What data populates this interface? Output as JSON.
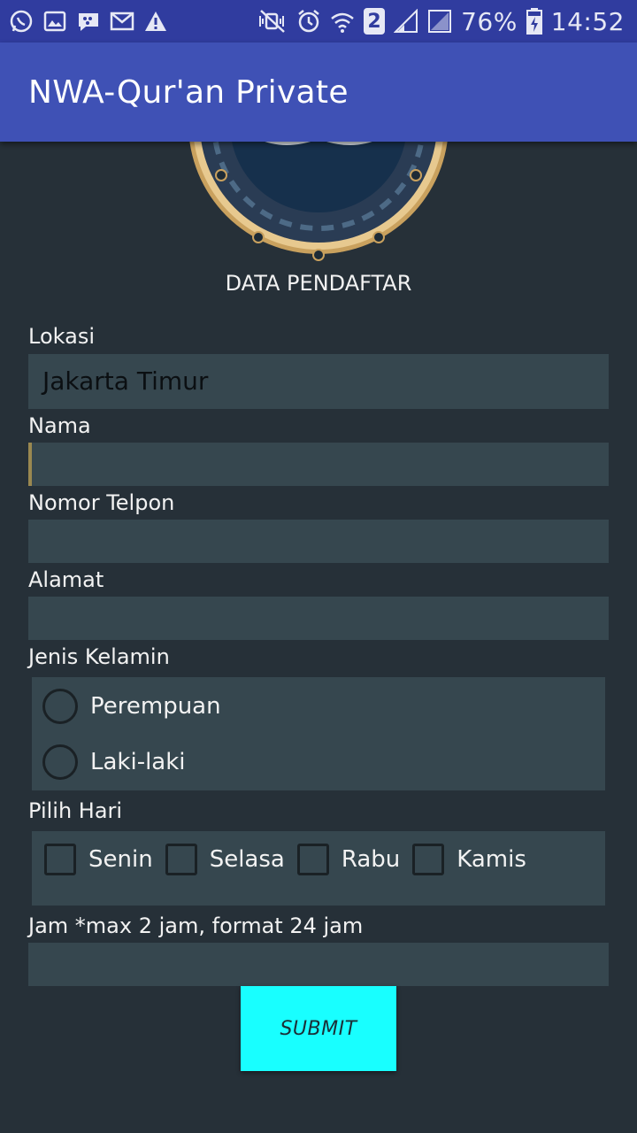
{
  "status_bar": {
    "left_icons": [
      "whatsapp-icon",
      "gallery-icon",
      "bbm-icon",
      "mail-icon",
      "warning-icon"
    ],
    "right_icons": [
      "mute-icon",
      "alarm-icon",
      "wifi-icon",
      "sim2-icon",
      "signal-icon",
      "battery-icon"
    ],
    "sim_slot": "2",
    "battery_percent": "76%",
    "time": "14:52"
  },
  "app_bar": {
    "title": "NWA-Qur'an Private"
  },
  "form": {
    "heading": "DATA PENDAFTAR",
    "lokasi": {
      "label": "Lokasi",
      "value": "Jakarta Timur"
    },
    "nama": {
      "label": "Nama",
      "value": ""
    },
    "nomor_telpon": {
      "label": "Nomor Telpon",
      "value": ""
    },
    "alamat": {
      "label": "Alamat",
      "value": ""
    },
    "jenis_kelamin": {
      "label": "Jenis Kelamin",
      "options": [
        "Perempuan",
        "Laki-laki"
      ]
    },
    "pilih_hari": {
      "label": "Pilih Hari",
      "options": [
        "Senin",
        "Selasa",
        "Rabu",
        "Kamis"
      ]
    },
    "jam": {
      "label": "Jam *max 2 jam, format 24 jam",
      "value": ""
    },
    "submit_label": "SUBMIT"
  },
  "colors": {
    "status_bar": "#303c9f",
    "app_bar": "#3f51b5",
    "background": "#263038",
    "field": "#36474f",
    "submit": "#18ffff"
  }
}
